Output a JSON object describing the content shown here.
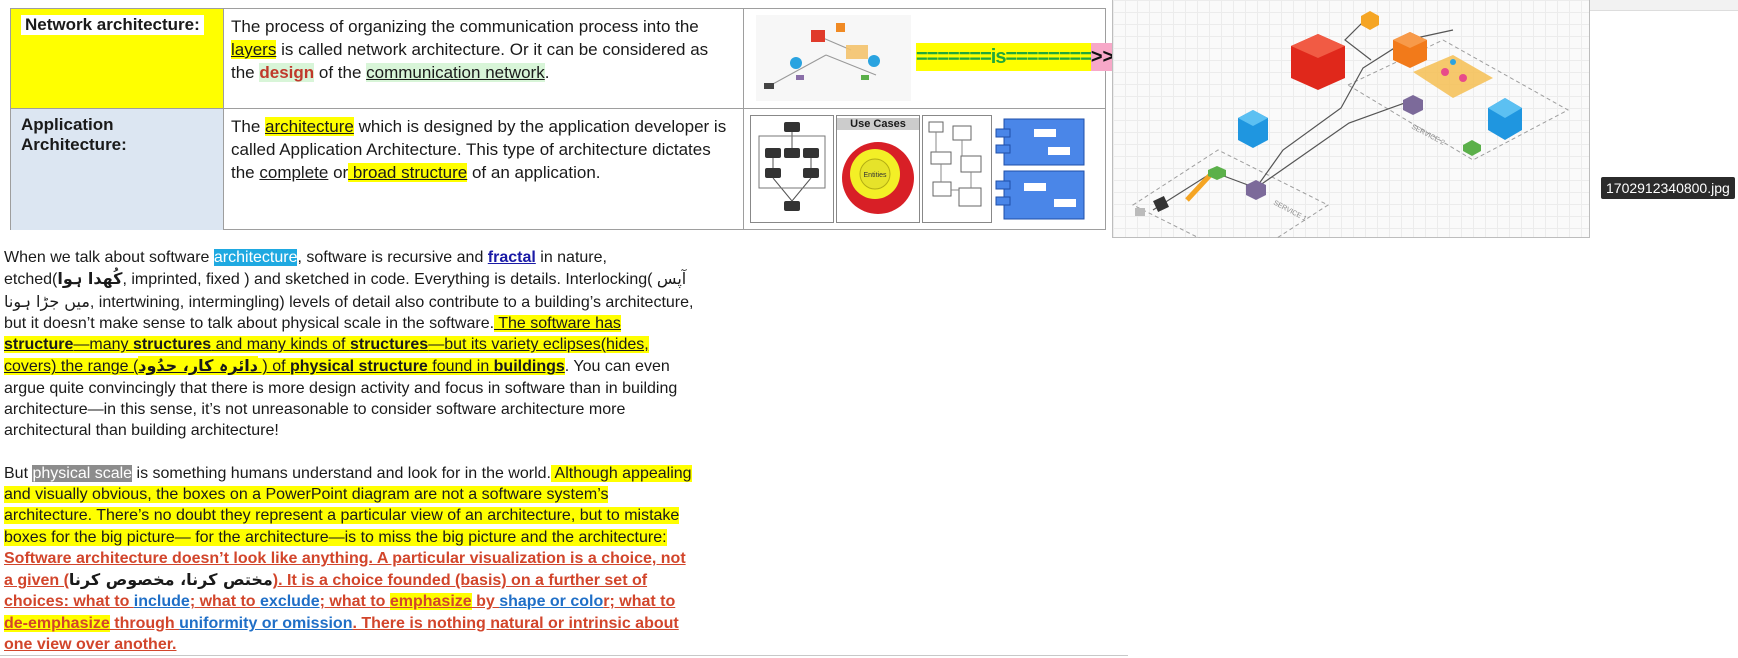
{
  "table": {
    "rows": [
      {
        "term": "Network architecture:",
        "def": {
          "p1": "The process of organizing the communication process into the ",
          "layers": "layers",
          "p2": " is called network architecture. Or it can be considered as the ",
          "design": "design",
          "p3": " of the ",
          "comm": "communication network",
          "p4": "."
        },
        "is_label": "=======is========",
        "arrow": ">>"
      },
      {
        "term": "Application Architecture:",
        "def": {
          "p1": "The ",
          "architecture": "architecture",
          "p2": " which is designed by the application developer is called Application Architecture. This type of architecture dictates the ",
          "complete": "complete",
          "p3": " or",
          "broad": " broad structure",
          "p4": " of an application."
        },
        "use_cases": "Use Cases",
        "entities": "Entities"
      }
    ]
  },
  "diagram": {
    "service1": "SERVICE 1",
    "service2": "SERVICE 2"
  },
  "filename": "1702912340800.jpg",
  "article": {
    "p1": {
      "a": "When we talk about software ",
      "architecture": "architecture",
      "b": ", software is recursive and ",
      "fractal": "fractal",
      "c": " in nature, etched(",
      "urdu1": "کُھدا ہوا",
      "d": ", imprinted, fixed ) and sketched in code. Everything is details. Interlocking( ",
      "urdu2": "آپس میں جڑا ہونا",
      "e": ", intertwining, intermingling) levels of detail also contribute to a building’s architecture, but it doesn’t make sense to talk about physical scale in the software.",
      "h1": " The software has ",
      "structure1": "structure",
      "h2": "—many ",
      "structures2": "structures",
      "h3": " and many kinds of ",
      "structures3": "structures",
      "h4": "—but its variety eclipses(hides, covers) the range (",
      "urdu3": "دائرہ کار، حدُود",
      "h5": " ) of ",
      "physical": "physical structure",
      "h6": " found in ",
      "buildings": "buildings",
      "f": ". You can even argue quite convincingly that there is more design activity and focus in software than in building architecture—in this sense, it’s not unreasonable to consider software architecture more architectural than building architecture!"
    },
    "p2": {
      "a": "But ",
      "physical_scale": "physical scale",
      "b": " is something humans understand and look for in the world.",
      "h1": " Although appealing and visually obvious, the boxes on a PowerPoint diagram are not a software system’s architecture. There’s no doubt they represent a particular view of an architecture, but to mistake boxes for the big picture— for the architecture—is to miss the big picture and the architecture:",
      "r1": " Software architecture doesn’t look like anything. A particular visualization is a choice, not a given (",
      "urdu4": "مختص کرنا، مخصوص کرنا",
      "r2": "). It is a choice founded (basis) on a further set of choices: what to ",
      "include": "include",
      "r3": "; what to ",
      "exclude": "exclude",
      "r4": "; what to ",
      "emphasize": "emphasize",
      "r5": " by ",
      "shape": "shape or colo",
      "r6": "r; what to ",
      "deemph": "de-emphasize",
      "r7": " through ",
      "uniform": "uniformity or omission",
      "r8": ". There is nothing natural or intrinsic about one view over another."
    }
  }
}
